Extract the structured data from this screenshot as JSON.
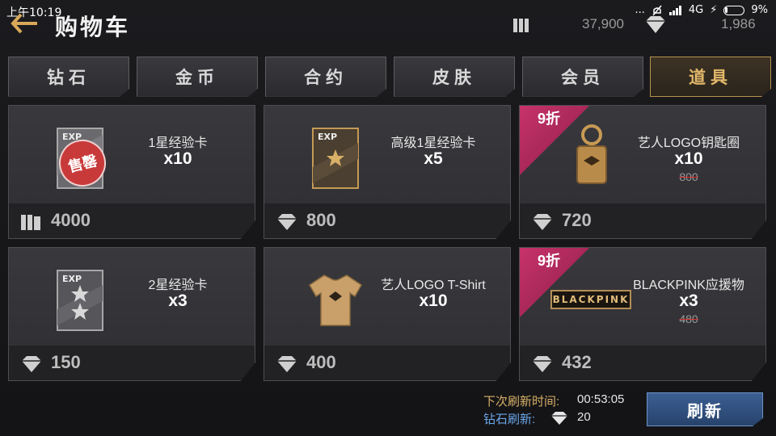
{
  "status_bar": {
    "time": "上午10:19",
    "indicators": "... ",
    "network": "4G",
    "battery": "9%"
  },
  "header": {
    "back_icon": "back-arrow-icon",
    "title": "购物车",
    "coins": {
      "icon": "coin-stack-icon",
      "value": "37,900"
    },
    "diamonds": {
      "icon": "diamond-icon",
      "value": "1,986"
    }
  },
  "tabs": [
    {
      "label": "钻石",
      "active": false
    },
    {
      "label": "金币",
      "active": false
    },
    {
      "label": "合约",
      "active": false
    },
    {
      "label": "皮肤",
      "active": false
    },
    {
      "label": "会员",
      "active": false
    },
    {
      "label": "道具",
      "active": true
    }
  ],
  "items": [
    {
      "name": "1星经验卡",
      "qty": "x10",
      "price": "4000",
      "currency": "coin-stack-icon",
      "soldout": "售罄",
      "thumb": "exp-card-silver-icon"
    },
    {
      "name": "高级1星经验卡",
      "qty": "x5",
      "price": "800",
      "currency": "diamond-icon",
      "thumb": "exp-card-gold-icon"
    },
    {
      "name": "艺人LOGO钥匙圈",
      "qty": "x10",
      "old_price": "800",
      "price": "720",
      "discount": "9折",
      "currency": "diamond-icon",
      "thumb": "keychain-icon"
    },
    {
      "name": "2星经验卡",
      "qty": "x3",
      "price": "150",
      "currency": "diamond-icon",
      "thumb": "exp-card-2star-icon"
    },
    {
      "name": "艺人LOGO T-Shirt",
      "qty": "x10",
      "price": "400",
      "currency": "diamond-icon",
      "thumb": "tshirt-icon"
    },
    {
      "name": "BLACKPINK应援物",
      "qty": "x3",
      "old_price": "480",
      "price": "432",
      "discount": "9折",
      "currency": "diamond-icon",
      "thumb": "blackpink-banner-icon",
      "thumb_text": "BLACKPINK"
    }
  ],
  "footer": {
    "next_refresh_label": "下次刷新时间:",
    "next_refresh_value": "00:53:05",
    "diamond_refresh_label": "钻石刷新:",
    "diamond_refresh_cost": "20",
    "refresh_button": "刷新"
  },
  "colors": {
    "accent_gold": "#d8b068",
    "accent_blue": "#6aa6e8",
    "discount_pink": "#c7336a",
    "refresh_blue": "#3b5f92"
  }
}
